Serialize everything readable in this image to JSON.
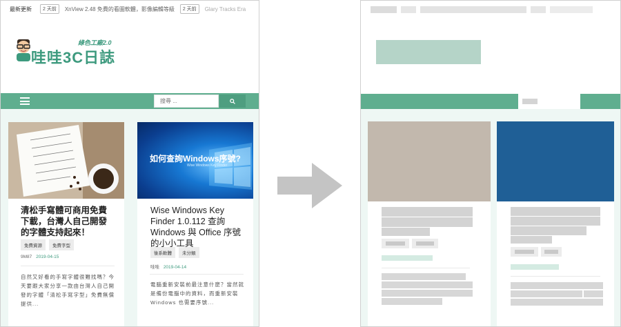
{
  "ticker": {
    "label": "最新更新",
    "items": [
      {
        "badge": "2 天前",
        "text": "XnView 2.48 免費的看圖軟體，影像編輯等級"
      },
      {
        "badge": "2 天前",
        "text": "Glary Tracks Era"
      }
    ]
  },
  "logo": {
    "subtitle": "綠色工廠2.0",
    "title": "哇哇3C日誌"
  },
  "search": {
    "placeholder": "搜尋 ...",
    "icon": "magnifier-icon"
  },
  "posts": [
    {
      "image_caption": "",
      "title": "清松手寫體可商用免費下載，台灣人自己開發的字體支持起來！",
      "tags": [
        "免費資源",
        "免費字型"
      ],
      "author": "9M87",
      "date": "2019-04-15",
      "excerpt": "自然又好看的手寫字體很難找嗎？今天要跟大家分享一款由台灣人自己開發的字體「清松手寫字型」免費無償提供..."
    },
    {
      "image_caption": "如何查詢Windows序號?",
      "image_subcaption": "Wise Windows Key Finder",
      "title": "Wise Windows Key Finder 1.0.112 查詢 Windows 與 Office 序號的小小工具",
      "tags": [
        "後系軟體",
        "未分類"
      ],
      "author": "哇哇",
      "date": "2019-04-14",
      "excerpt": "電腦重新安裝前最注意什麼？當然就是備份電腦中的資料，而重新安裝 Windows 也需要序號..."
    }
  ],
  "colors": {
    "brand": "#5fae8f",
    "brand_dark": "#3d9a7e",
    "content_bg": "#eef7f4",
    "skeleton": "#cccccc",
    "arrow": "#c4c4c4"
  }
}
